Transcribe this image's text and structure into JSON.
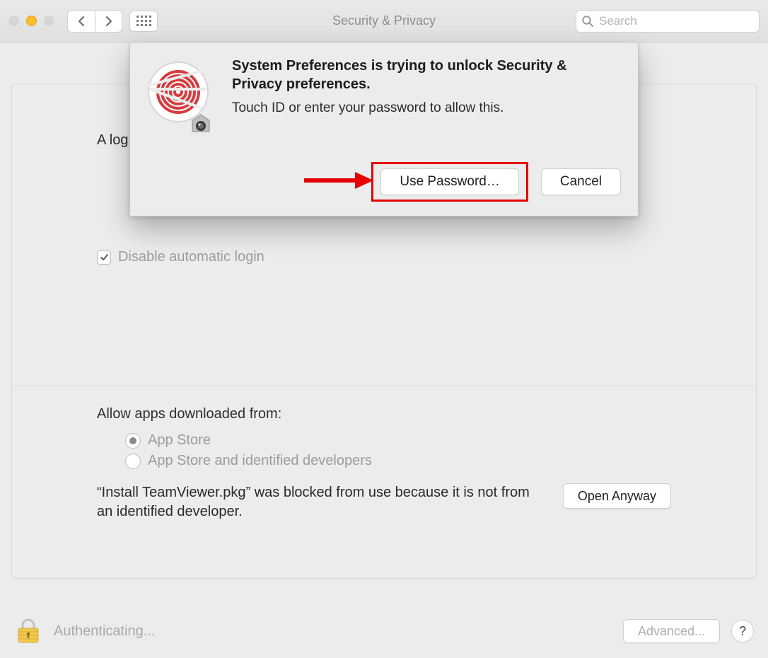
{
  "toolbar": {
    "title": "Security & Privacy",
    "search_placeholder": "Search"
  },
  "main": {
    "login_line_partial": "A log",
    "disable_auto_login": {
      "label": "Disable automatic login",
      "checked": true
    },
    "allow_apps_label": "Allow apps downloaded from:",
    "radios": [
      {
        "label": "App Store",
        "selected": true
      },
      {
        "label": "App Store and identified developers",
        "selected": false
      }
    ],
    "blocked_text": "“Install TeamViewer.pkg” was blocked from use because it is not from an identified developer.",
    "open_anyway": "Open Anyway"
  },
  "footer": {
    "status": "Authenticating...",
    "advanced": "Advanced...",
    "help": "?"
  },
  "sheet": {
    "heading": "System Preferences is trying to unlock Security & Privacy preferences.",
    "sub": "Touch ID or enter your password to allow this.",
    "use_password": "Use Password…",
    "cancel": "Cancel"
  }
}
